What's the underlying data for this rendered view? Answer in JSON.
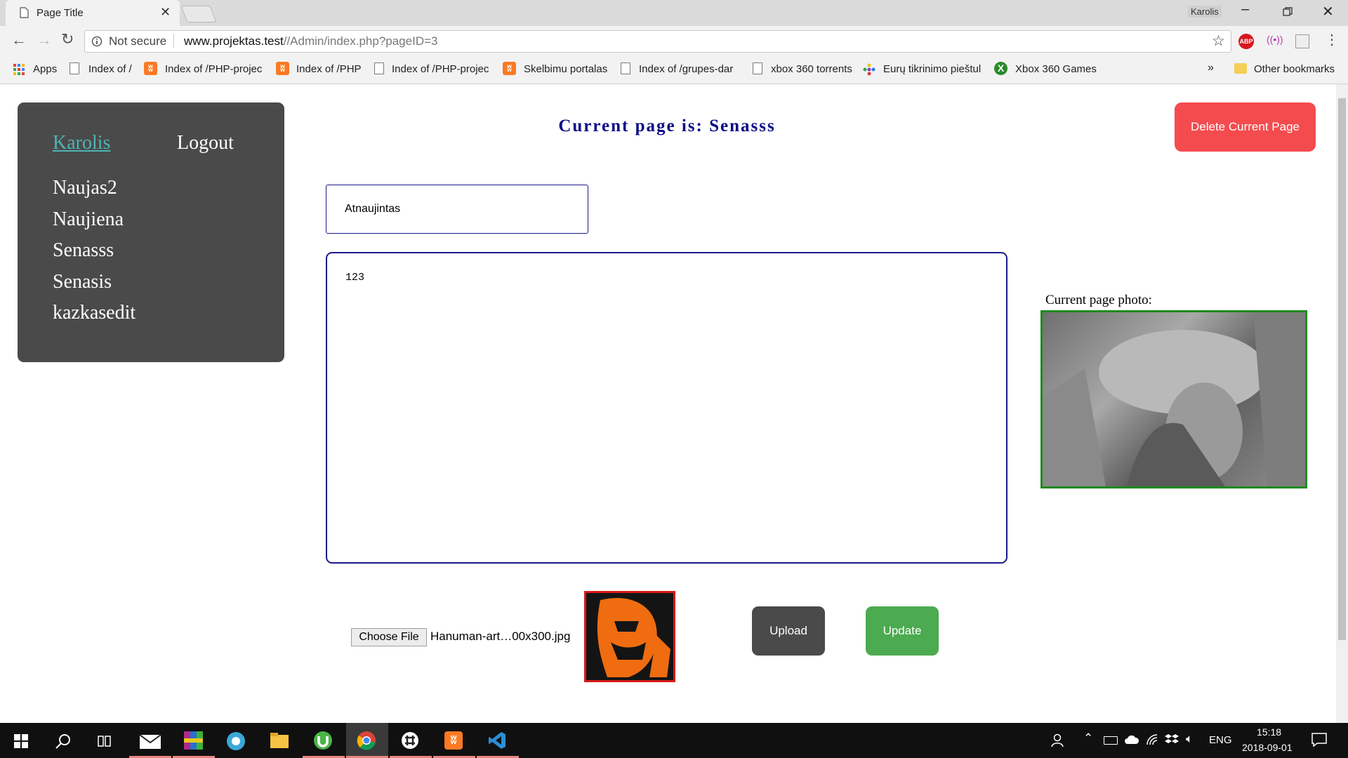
{
  "browser": {
    "tab_title": "Page Title",
    "profile_name": "Karolis",
    "security_label": "Not secure",
    "url_host": "www.projektas.test",
    "url_path": "//Admin/index.php?pageID=3",
    "extension_abp": "ABP",
    "more_bookmarks": "»",
    "bookmarks": [
      {
        "label": "Apps",
        "icon": "apps-grid-icon"
      },
      {
        "label": "Index of /",
        "icon": "page-icon"
      },
      {
        "label": "Index of /PHP-projec",
        "icon": "xampp-icon"
      },
      {
        "label": "Index of /PHP",
        "icon": "xampp-icon"
      },
      {
        "label": "Index of /PHP-projec",
        "icon": "page-icon"
      },
      {
        "label": "Skelbimu portalas",
        "icon": "xampp-icon"
      },
      {
        "label": "Index of /grupes-dar",
        "icon": "page-icon"
      },
      {
        "label": "xbox 360 torrents",
        "icon": "page-icon"
      },
      {
        "label": "Eurų tikrinimo pieštul",
        "icon": "colorful-dots-icon"
      },
      {
        "label": "Xbox 360 Games",
        "icon": "xbox-icon"
      }
    ],
    "other_bookmarks": "Other bookmarks"
  },
  "sidebar": {
    "user": "Karolis",
    "logout": "Logout",
    "pages": [
      "Naujas2",
      "Naujiena",
      "Senasss",
      "Senasis",
      "kazkasedit"
    ],
    "background": "#4a4a4a"
  },
  "main": {
    "heading": "Current page is: Senasss",
    "delete_button": "Delete Current Page",
    "title_value": "Atnaujintas",
    "content_value": "123",
    "photo_label": "Current page photo:",
    "choose_file": "Choose File",
    "file_name": "Hanuman-art…00x300.jpg",
    "upload_button": "Upload",
    "update_button": "Update",
    "colors": {
      "delete": "#f44b4f",
      "upload": "#4a4a4a",
      "update": "#4caa50",
      "heading": "#0b0b85",
      "photo_border": "#1e8a1e",
      "thumb_border": "#d81919"
    }
  },
  "taskbar": {
    "language": "ENG",
    "time": "15:18",
    "date": "2018-09-01",
    "apps": [
      "start-icon",
      "search-icon",
      "task-view-icon",
      "mail-icon",
      "winrar-icon",
      "app-icon",
      "file-explorer-icon",
      "utorrent-icon",
      "chrome-icon",
      "slack-icon",
      "xampp-icon",
      "vscode-icon"
    ]
  }
}
